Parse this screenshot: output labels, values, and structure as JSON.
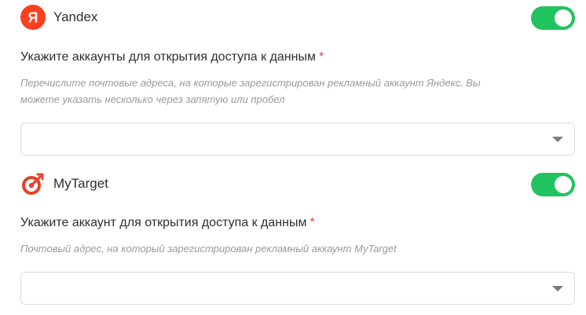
{
  "yandex": {
    "name": "Yandex",
    "logo_letter": "Я",
    "logo_color": "#fc3f1d",
    "enabled": true,
    "field_label": "Укажите аккаунты для открытия доступа к данным",
    "required_mark": "*",
    "hint_line1": "Перечислите почтовые адреса, на которые зарегистрирован рекламный аккаунт Яндекс. Вы",
    "hint_line2": "можете указать несколько через запятую или пробел",
    "select_value": ""
  },
  "mytarget": {
    "name": "MyTarget",
    "logo_color": "#e8412b",
    "enabled": true,
    "field_label": "Укажите аккаунт для открытия доступа к данным",
    "required_mark": "*",
    "hint": "Почтовый адрес, на который зарегистрирован рекламный аккаунт MyTarget",
    "select_value": ""
  },
  "colors": {
    "toggle_on": "#21c35e",
    "required": "#e8412b",
    "hint_text": "#9a9a9a"
  },
  "icons": {
    "yandex": "yandex-logo-icon",
    "mytarget": "mytarget-logo-icon",
    "dropdown": "chevron-down-icon"
  }
}
